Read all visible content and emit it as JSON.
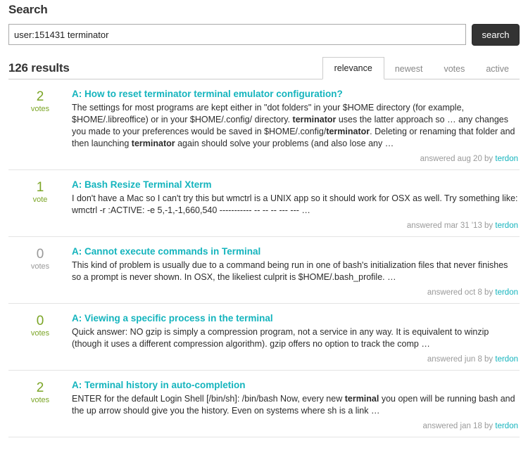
{
  "header": {
    "title": "Search"
  },
  "search": {
    "value": "user:151431 terminator",
    "placeholder": "search",
    "button_label": "search"
  },
  "results_summary": {
    "count_label": "126 results",
    "count": 126
  },
  "tabs": [
    {
      "label": "relevance",
      "active": true
    },
    {
      "label": "newest",
      "active": false
    },
    {
      "label": "votes",
      "active": false
    },
    {
      "label": "active",
      "active": false
    }
  ],
  "results": [
    {
      "votes": "2",
      "votes_label": "votes",
      "votes_zero": false,
      "title": "A: How to reset terminator terminal emulator configuration?",
      "excerpt_parts": [
        {
          "text": "The settings for most programs are kept either in \"dot folders\" in your $HOME directory (for example, $HOME/.libreoffice) or in your $HOME/.config/ directory. ",
          "bold": false
        },
        {
          "text": "terminator",
          "bold": true
        },
        {
          "text": " uses the latter approach so … any changes you made to your preferences would be saved in $HOME/.config/",
          "bold": false
        },
        {
          "text": "terminator",
          "bold": true
        },
        {
          "text": ". Deleting or renaming that folder and then launching ",
          "bold": false
        },
        {
          "text": "terminator",
          "bold": true
        },
        {
          "text": " again should solve your problems (and also lose any …",
          "bold": false
        }
      ],
      "meta_prefix": "answered aug 20 by",
      "meta_user": "terdon"
    },
    {
      "votes": "1",
      "votes_label": "vote",
      "votes_zero": false,
      "title": "A: Bash Resize Terminal Xterm",
      "excerpt_parts": [
        {
          "text": "I don't have a Mac so I can't try this but wmctrl is a UNIX app so it should work for OSX as well. Try something like: wmctrl -r :ACTIVE: -e 5,-1,-1,660,540 ----------- -- -- -- --- --- …",
          "bold": false
        }
      ],
      "meta_prefix": "answered mar 31 '13 by",
      "meta_user": "terdon"
    },
    {
      "votes": "0",
      "votes_label": "votes",
      "votes_zero": true,
      "title": "A: Cannot execute commands in Terminal",
      "excerpt_parts": [
        {
          "text": "This kind of problem is usually due to a command being run in one of bash's initialization files that never finishes so a prompt is never shown. In OSX, the likeliest culprit is $HOME/.bash_profile. …",
          "bold": false
        }
      ],
      "meta_prefix": "answered oct 8 by",
      "meta_user": "terdon"
    },
    {
      "votes": "0",
      "votes_label": "votes",
      "votes_zero": false,
      "title": "A: Viewing a specific process in the terminal",
      "excerpt_parts": [
        {
          "text": "Quick answer: NO gzip is simply a compression program, not a service in any way. It is equivalent to winzip (though it uses a different compression algorithm). gzip offers no option to track the comp …",
          "bold": false
        }
      ],
      "meta_prefix": "answered jun 8 by",
      "meta_user": "terdon"
    },
    {
      "votes": "2",
      "votes_label": "votes",
      "votes_zero": false,
      "title": "A: Terminal history in auto-completion",
      "excerpt_parts": [
        {
          "text": "ENTER for the default Login Shell [/bin/sh]: /bin/bash Now, every new ",
          "bold": false
        },
        {
          "text": "terminal",
          "bold": true
        },
        {
          "text": " you open will be running bash and the up arrow should give you the history. Even on systems where sh is a link …",
          "bold": false
        }
      ],
      "meta_prefix": "answered jan 18 by",
      "meta_user": "terdon"
    }
  ],
  "colors": {
    "link": "#14b4bd",
    "votes_green": "#7ba526",
    "votes_gray": "#999999",
    "button_bg": "#333333",
    "border": "#cccccc"
  }
}
